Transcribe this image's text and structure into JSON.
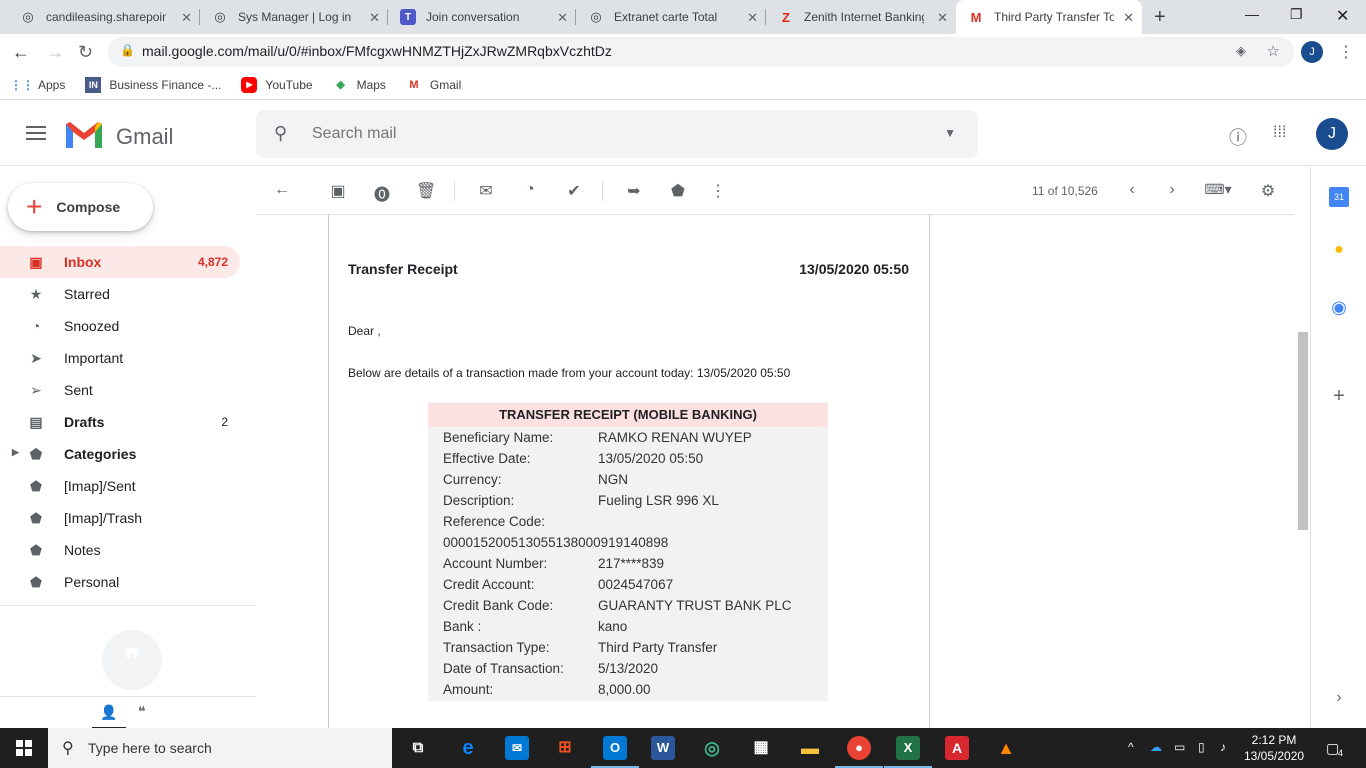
{
  "browser": {
    "tabs": [
      {
        "label": "candileasing.sharepoint.com",
        "icon": "globe-icon"
      },
      {
        "label": "Sys Manager | Log in",
        "icon": "globe-icon"
      },
      {
        "label": "Join conversation",
        "icon": "teams-icon"
      },
      {
        "label": "Extranet carte Total",
        "icon": "globe-icon"
      },
      {
        "label": "Zenith Internet Banking",
        "icon": "zenith-icon"
      },
      {
        "label": "Third Party Transfer To B",
        "icon": "gmail-icon"
      }
    ],
    "url": "mail.google.com/mail/u/0/#inbox/FMfcgxwHNMZTHjZxJRwZMRqbxVczhtDz",
    "profile_initial": "J",
    "bookmarks": [
      {
        "label": "Apps"
      },
      {
        "label": "Business Finance -..."
      },
      {
        "label": "YouTube"
      },
      {
        "label": "Maps"
      },
      {
        "label": "Gmail"
      }
    ]
  },
  "gmail": {
    "app_name": "Gmail",
    "search_placeholder": "Search mail",
    "avatar_initial": "J",
    "compose_label": "Compose",
    "nav": [
      {
        "label": "Inbox",
        "count": "4,872"
      },
      {
        "label": "Starred",
        "count": ""
      },
      {
        "label": "Snoozed",
        "count": ""
      },
      {
        "label": "Important",
        "count": ""
      },
      {
        "label": "Sent",
        "count": ""
      },
      {
        "label": "Drafts",
        "count": "2"
      },
      {
        "label": "Categories",
        "count": ""
      },
      {
        "label": "[Imap]/Sent",
        "count": ""
      },
      {
        "label": "[Imap]/Trash",
        "count": ""
      },
      {
        "label": "Notes",
        "count": ""
      },
      {
        "label": "Personal",
        "count": ""
      }
    ],
    "pager": "11 of 10,526"
  },
  "email": {
    "title": "Transfer Receipt",
    "date": "13/05/2020 05:50",
    "greeting": "Dear ,",
    "intro": "Below are details of a transaction made from your account today: 13/05/2020 05:50",
    "receipt_heading": "TRANSFER RECEIPT (MOBILE BANKING)",
    "rows": [
      {
        "label": "Beneficiary Name:",
        "value": "RAMKO RENAN WUYEP"
      },
      {
        "label": "Effective Date:",
        "value": "13/05/2020 05:50"
      },
      {
        "label": "Currency:",
        "value": "NGN"
      },
      {
        "label": "Description:",
        "value": "Fueling LSR 996 XL"
      },
      {
        "label": "Reference Code:",
        "value": ""
      },
      {
        "label": "000015200513055138000919140898",
        "value": ""
      },
      {
        "label": "Account Number:",
        "value": "217****839"
      },
      {
        "label": "Credit Account:",
        "value": "0024547067"
      },
      {
        "label": "Credit Bank Code:",
        "value": "GUARANTY TRUST BANK PLC"
      },
      {
        "label": "Bank :",
        "value": "kano"
      },
      {
        "label": "Transaction Type:",
        "value": "Third Party Transfer"
      },
      {
        "label": "Date of Transaction:",
        "value": "5/13/2020"
      },
      {
        "label": "Amount:",
        "value": "8,000.00"
      }
    ]
  },
  "taskbar": {
    "search_placeholder": "Type here to search",
    "time": "2:12 PM",
    "date": "13/05/2020",
    "notifications": "4"
  },
  "colors": {
    "gmail_red": "#d93025",
    "receipt_header_bg": "#fde0e0",
    "receipt_bg": "#f2f2f2",
    "avatar": "#1a4d8f"
  }
}
